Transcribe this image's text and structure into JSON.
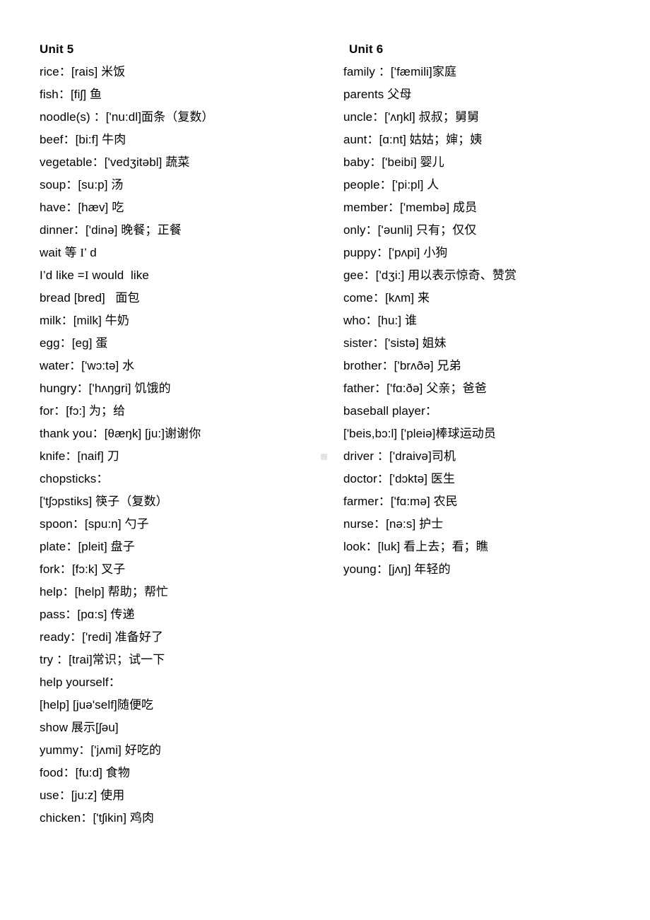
{
  "document": {
    "background_color": "#ffffff",
    "text_color": "#000000",
    "artifact_color": "#e4e4e4"
  },
  "columns": {
    "left": {
      "heading": "Unit 5",
      "entries": [
        "rice：[rais] 米饭",
        "fish：[fiʃ] 鱼",
        "noodle(s) ：['nu:dl]面条（复数）",
        "beef：[bi:f] 牛肉",
        "vegetable：['vedʒitəbl] 蔬菜",
        "soup：[su:p] 汤",
        "have：[hæv] 吃",
        "dinner：['dinə] 晚餐；正餐",
        "wait 等 I’ d",
        "I’d like =I would  like",
        "bread [bred]   面包",
        "milk：[milk] 牛奶",
        "egg：[eg] 蛋",
        "water：['wɔ:tə] 水",
        "hungry：['hʌŋgri] 饥饿的",
        "for：[fɔ:] 为；给",
        "thank you：[θæŋk] [ju:]谢谢你",
        "knife：[naif] 刀",
        "chopsticks：",
        "['tʃɔpstiks] 筷子（复数）",
        "spoon：[spu:n] 勺子",
        "plate：[pleit] 盘子",
        "fork：[fɔ:k] 叉子",
        "help：[help] 帮助；帮忙",
        "pass：[pɑ:s] 传递",
        "ready：['redi] 准备好了",
        "try ：[trai]常识；试一下",
        "help yourself：",
        "[help] [juə'self]随便吃",
        "show 展示[ʃəu]",
        "yummy：['jʌmi] 好吃的",
        "food：[fu:d] 食物",
        "use：[ju:z] 使用",
        "chicken：['tʃikin] 鸡肉"
      ]
    },
    "right": {
      "heading": "Unit 6",
      "entries": [
        "family ：['fæmili]家庭",
        "parents 父母",
        "uncle：['ʌŋkl] 叔叔；舅舅",
        "aunt：[ɑ:nt] 姑姑；婶；姨",
        "baby：['beibi] 婴儿",
        "people：['pi:pl] 人",
        "member：['membə] 成员",
        "only：['əunli] 只有；仅仅",
        "puppy：['pʌpi] 小狗",
        "gee：['dʒi:] 用以表示惊奇、赞赏",
        "come：[kʌm] 来",
        "who：[hu:] 谁",
        "sister：['sistə] 姐妹",
        "brother：['brʌðə] 兄弟",
        "father：['fɑ:ðə] 父亲；爸爸",
        "baseball player：",
        "['beis,bɔ:l] ['pleiə]棒球运动员",
        "driver ：['draivə]司机",
        "doctor：['dɔktə] 医生",
        "farmer：['fɑ:mə] 农民",
        "nurse：[nə:s] 护士",
        "look：[luk] 看上去；看；瞧",
        "young：[jʌŋ] 年轻的"
      ]
    }
  }
}
